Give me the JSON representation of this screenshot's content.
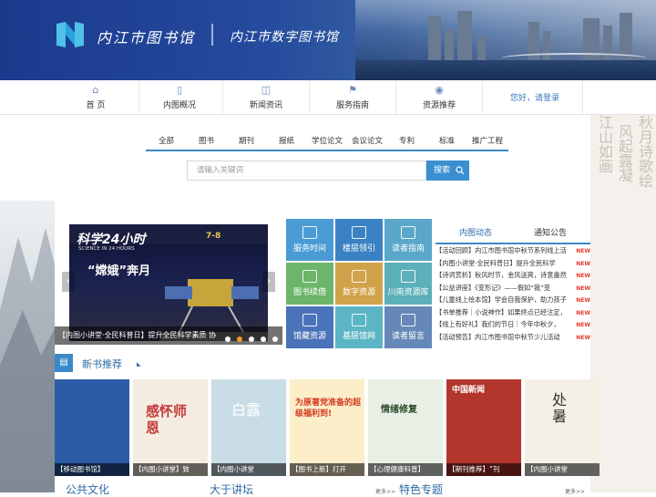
{
  "header": {
    "title": "内江市图书馆",
    "subtitle": "内江市数字图书馆"
  },
  "nav": {
    "items": [
      {
        "label": "首 页",
        "icon": "home-icon"
      },
      {
        "label": "内图概况",
        "icon": "book-icon"
      },
      {
        "label": "新闻资讯",
        "icon": "camera-icon"
      },
      {
        "label": "服务指南",
        "icon": "flag-icon"
      },
      {
        "label": "资源推荐",
        "icon": "camera-icon"
      }
    ],
    "login": "您好，请登录"
  },
  "search": {
    "tabs": [
      "全部",
      "图书",
      "期刊",
      "报纸",
      "学位论文",
      "会议论文",
      "专利",
      "标准",
      "推广工程"
    ],
    "placeholder": "请输入关键词",
    "button": "搜索"
  },
  "slider": {
    "caption": "【内图小讲堂·全民科普日】提升全民科学素质 协",
    "magazine": "科学24小时",
    "magazine_en": "SCIENCE IN 24 HOURS",
    "issue": "7-8",
    "headline": "“嫦娥”奔月"
  },
  "services": [
    {
      "label": "服务时间",
      "color": "#4a9bd4"
    },
    {
      "label": "楼层领引",
      "color": "#3b82c4"
    },
    {
      "label": "读者指南",
      "color": "#5aa7c9"
    },
    {
      "label": "图书续借",
      "color": "#6cb56a"
    },
    {
      "label": "数字资源",
      "color": "#d0a24a"
    },
    {
      "label": "川南资源库",
      "color": "#5bb0b9"
    },
    {
      "label": "馆藏资源",
      "color": "#4b73b9"
    },
    {
      "label": "基层馆网",
      "color": "#5cb5c4"
    },
    {
      "label": "读者留言",
      "color": "#6688b8"
    }
  ],
  "news": {
    "tabs": [
      "内图动态",
      "通知公告"
    ],
    "items": [
      "【活动回顾】内江市图书馆中秋节系列线上活",
      "【内图小讲堂·全民科普日】提升全民科学",
      "【诗词赏析】秋风时节，金风送爽，诗意盎然",
      "【公益讲座】《变形记》——假如“我”变",
      "【儿童线上绘本馆】学会自我保护，助力孩子",
      "【书单推荐｜小说神作】如果终点已经注定，",
      "【线上有好礼】我们的节日｜今年中秋夕，",
      "【活动预告】内江市图书馆中秋节少儿活动"
    ],
    "badge": "NEW"
  },
  "new_books": {
    "title": "新书推荐",
    "items": [
      {
        "caption": "【移动图书馆】",
        "text": "",
        "bg": "#2c5ca8"
      },
      {
        "caption": "【内图小讲堂】致",
        "text": "感怀师恩",
        "bg": "#f4ece1"
      },
      {
        "caption": "【内图小讲堂",
        "text": "白露",
        "bg": "#c9dde6"
      },
      {
        "caption": "【图书上新】打开",
        "text": "为原著党准备的超级福利到!",
        "bg": "#fbeec9"
      },
      {
        "caption": "【心理健康科普】",
        "text": "情绪修复",
        "bg": "#e8f0e6"
      },
      {
        "caption": "【期刊推荐】“刊",
        "text": "中国新闻",
        "bg": "#b3362d"
      },
      {
        "caption": "【内图小讲堂",
        "text": "处暑",
        "bg": "#f5f0e6"
      }
    ]
  },
  "bottom": {
    "sections": [
      "公共文化",
      "大于讲坛",
      "特色专题"
    ],
    "more": "更多>>"
  }
}
